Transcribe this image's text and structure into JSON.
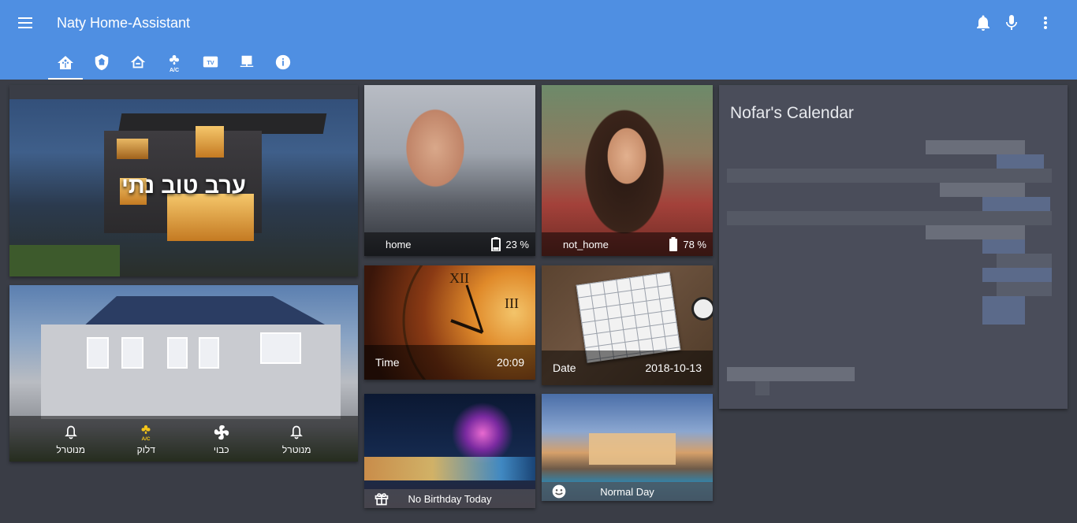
{
  "header": {
    "title": "Naty Home-Assistant",
    "icons": [
      "menu-icon",
      "bell-icon",
      "microphone-icon",
      "more-vertical-icon"
    ]
  },
  "tabs": [
    {
      "icon": "home-assistant-icon",
      "active": true
    },
    {
      "icon": "shield-home-icon",
      "active": false
    },
    {
      "icon": "home-outline-icon",
      "active": false
    },
    {
      "icon": "air-conditioner-icon",
      "active": false
    },
    {
      "icon": "tv-icon",
      "active": false
    },
    {
      "icon": "desktop-icon",
      "active": false
    },
    {
      "icon": "info-icon",
      "active": false
    }
  ],
  "greeting": {
    "text": "ערב טוב נתי"
  },
  "devices": [
    {
      "label": "מנוטרל",
      "icon": "bell-icon",
      "color": "#ffffff"
    },
    {
      "label": "דלוק",
      "icon": "air-conditioner-icon",
      "color": "#f5c518"
    },
    {
      "label": "כבוי",
      "icon": "fan-icon",
      "color": "#ffffff"
    },
    {
      "label": "מנוטרל",
      "icon": "bell-icon",
      "color": "#ffffff"
    }
  ],
  "persons": [
    {
      "state": "home",
      "battery": "23 %"
    },
    {
      "state": "not_home",
      "battery": "78 %"
    }
  ],
  "sensors": {
    "time": {
      "label": "Time",
      "value": "20:09"
    },
    "date": {
      "label": "Date",
      "value": "2018-10-13"
    }
  },
  "calendar": {
    "title": "Nofar's Calendar"
  },
  "bottom_cards": {
    "birthday": {
      "label": "No Birthday Today",
      "icon": "gift-icon"
    },
    "day": {
      "label": "Normal Day",
      "icon": "face-icon"
    }
  },
  "colors": {
    "header_bg": "#4f8fe2",
    "page_bg": "#3a3d46",
    "card_bg": "#4a4d58",
    "accent_on": "#f5c518"
  }
}
